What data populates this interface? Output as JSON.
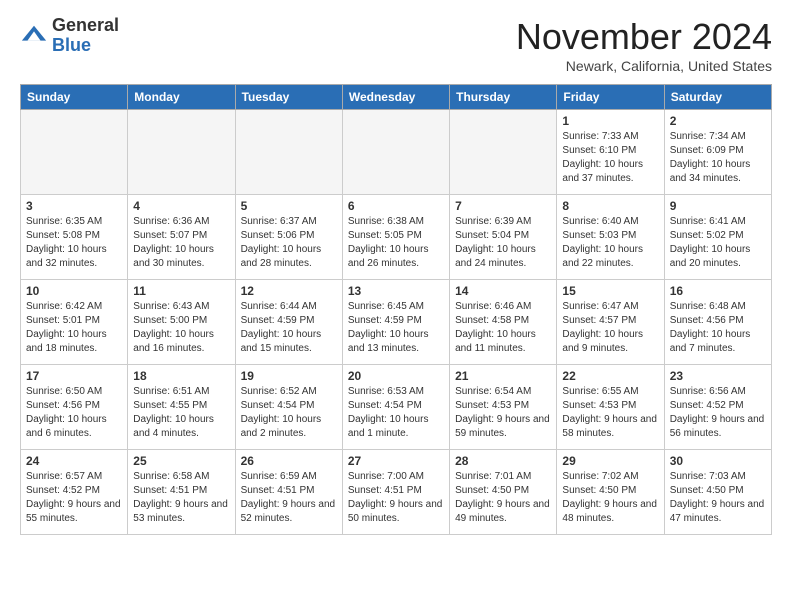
{
  "header": {
    "logo_general": "General",
    "logo_blue": "Blue",
    "month_title": "November 2024",
    "location": "Newark, California, United States"
  },
  "weekdays": [
    "Sunday",
    "Monday",
    "Tuesday",
    "Wednesday",
    "Thursday",
    "Friday",
    "Saturday"
  ],
  "weeks": [
    [
      {
        "day": "",
        "empty": true
      },
      {
        "day": "",
        "empty": true
      },
      {
        "day": "",
        "empty": true
      },
      {
        "day": "",
        "empty": true
      },
      {
        "day": "",
        "empty": true
      },
      {
        "day": "1",
        "sunrise": "Sunrise: 7:33 AM",
        "sunset": "Sunset: 6:10 PM",
        "daylight": "Daylight: 10 hours and 37 minutes."
      },
      {
        "day": "2",
        "sunrise": "Sunrise: 7:34 AM",
        "sunset": "Sunset: 6:09 PM",
        "daylight": "Daylight: 10 hours and 34 minutes."
      }
    ],
    [
      {
        "day": "3",
        "sunrise": "Sunrise: 6:35 AM",
        "sunset": "Sunset: 5:08 PM",
        "daylight": "Daylight: 10 hours and 32 minutes."
      },
      {
        "day": "4",
        "sunrise": "Sunrise: 6:36 AM",
        "sunset": "Sunset: 5:07 PM",
        "daylight": "Daylight: 10 hours and 30 minutes."
      },
      {
        "day": "5",
        "sunrise": "Sunrise: 6:37 AM",
        "sunset": "Sunset: 5:06 PM",
        "daylight": "Daylight: 10 hours and 28 minutes."
      },
      {
        "day": "6",
        "sunrise": "Sunrise: 6:38 AM",
        "sunset": "Sunset: 5:05 PM",
        "daylight": "Daylight: 10 hours and 26 minutes."
      },
      {
        "day": "7",
        "sunrise": "Sunrise: 6:39 AM",
        "sunset": "Sunset: 5:04 PM",
        "daylight": "Daylight: 10 hours and 24 minutes."
      },
      {
        "day": "8",
        "sunrise": "Sunrise: 6:40 AM",
        "sunset": "Sunset: 5:03 PM",
        "daylight": "Daylight: 10 hours and 22 minutes."
      },
      {
        "day": "9",
        "sunrise": "Sunrise: 6:41 AM",
        "sunset": "Sunset: 5:02 PM",
        "daylight": "Daylight: 10 hours and 20 minutes."
      }
    ],
    [
      {
        "day": "10",
        "sunrise": "Sunrise: 6:42 AM",
        "sunset": "Sunset: 5:01 PM",
        "daylight": "Daylight: 10 hours and 18 minutes."
      },
      {
        "day": "11",
        "sunrise": "Sunrise: 6:43 AM",
        "sunset": "Sunset: 5:00 PM",
        "daylight": "Daylight: 10 hours and 16 minutes."
      },
      {
        "day": "12",
        "sunrise": "Sunrise: 6:44 AM",
        "sunset": "Sunset: 4:59 PM",
        "daylight": "Daylight: 10 hours and 15 minutes."
      },
      {
        "day": "13",
        "sunrise": "Sunrise: 6:45 AM",
        "sunset": "Sunset: 4:59 PM",
        "daylight": "Daylight: 10 hours and 13 minutes."
      },
      {
        "day": "14",
        "sunrise": "Sunrise: 6:46 AM",
        "sunset": "Sunset: 4:58 PM",
        "daylight": "Daylight: 10 hours and 11 minutes."
      },
      {
        "day": "15",
        "sunrise": "Sunrise: 6:47 AM",
        "sunset": "Sunset: 4:57 PM",
        "daylight": "Daylight: 10 hours and 9 minutes."
      },
      {
        "day": "16",
        "sunrise": "Sunrise: 6:48 AM",
        "sunset": "Sunset: 4:56 PM",
        "daylight": "Daylight: 10 hours and 7 minutes."
      }
    ],
    [
      {
        "day": "17",
        "sunrise": "Sunrise: 6:50 AM",
        "sunset": "Sunset: 4:56 PM",
        "daylight": "Daylight: 10 hours and 6 minutes."
      },
      {
        "day": "18",
        "sunrise": "Sunrise: 6:51 AM",
        "sunset": "Sunset: 4:55 PM",
        "daylight": "Daylight: 10 hours and 4 minutes."
      },
      {
        "day": "19",
        "sunrise": "Sunrise: 6:52 AM",
        "sunset": "Sunset: 4:54 PM",
        "daylight": "Daylight: 10 hours and 2 minutes."
      },
      {
        "day": "20",
        "sunrise": "Sunrise: 6:53 AM",
        "sunset": "Sunset: 4:54 PM",
        "daylight": "Daylight: 10 hours and 1 minute."
      },
      {
        "day": "21",
        "sunrise": "Sunrise: 6:54 AM",
        "sunset": "Sunset: 4:53 PM",
        "daylight": "Daylight: 9 hours and 59 minutes."
      },
      {
        "day": "22",
        "sunrise": "Sunrise: 6:55 AM",
        "sunset": "Sunset: 4:53 PM",
        "daylight": "Daylight: 9 hours and 58 minutes."
      },
      {
        "day": "23",
        "sunrise": "Sunrise: 6:56 AM",
        "sunset": "Sunset: 4:52 PM",
        "daylight": "Daylight: 9 hours and 56 minutes."
      }
    ],
    [
      {
        "day": "24",
        "sunrise": "Sunrise: 6:57 AM",
        "sunset": "Sunset: 4:52 PM",
        "daylight": "Daylight: 9 hours and 55 minutes."
      },
      {
        "day": "25",
        "sunrise": "Sunrise: 6:58 AM",
        "sunset": "Sunset: 4:51 PM",
        "daylight": "Daylight: 9 hours and 53 minutes."
      },
      {
        "day": "26",
        "sunrise": "Sunrise: 6:59 AM",
        "sunset": "Sunset: 4:51 PM",
        "daylight": "Daylight: 9 hours and 52 minutes."
      },
      {
        "day": "27",
        "sunrise": "Sunrise: 7:00 AM",
        "sunset": "Sunset: 4:51 PM",
        "daylight": "Daylight: 9 hours and 50 minutes."
      },
      {
        "day": "28",
        "sunrise": "Sunrise: 7:01 AM",
        "sunset": "Sunset: 4:50 PM",
        "daylight": "Daylight: 9 hours and 49 minutes."
      },
      {
        "day": "29",
        "sunrise": "Sunrise: 7:02 AM",
        "sunset": "Sunset: 4:50 PM",
        "daylight": "Daylight: 9 hours and 48 minutes."
      },
      {
        "day": "30",
        "sunrise": "Sunrise: 7:03 AM",
        "sunset": "Sunset: 4:50 PM",
        "daylight": "Daylight: 9 hours and 47 minutes."
      }
    ]
  ]
}
